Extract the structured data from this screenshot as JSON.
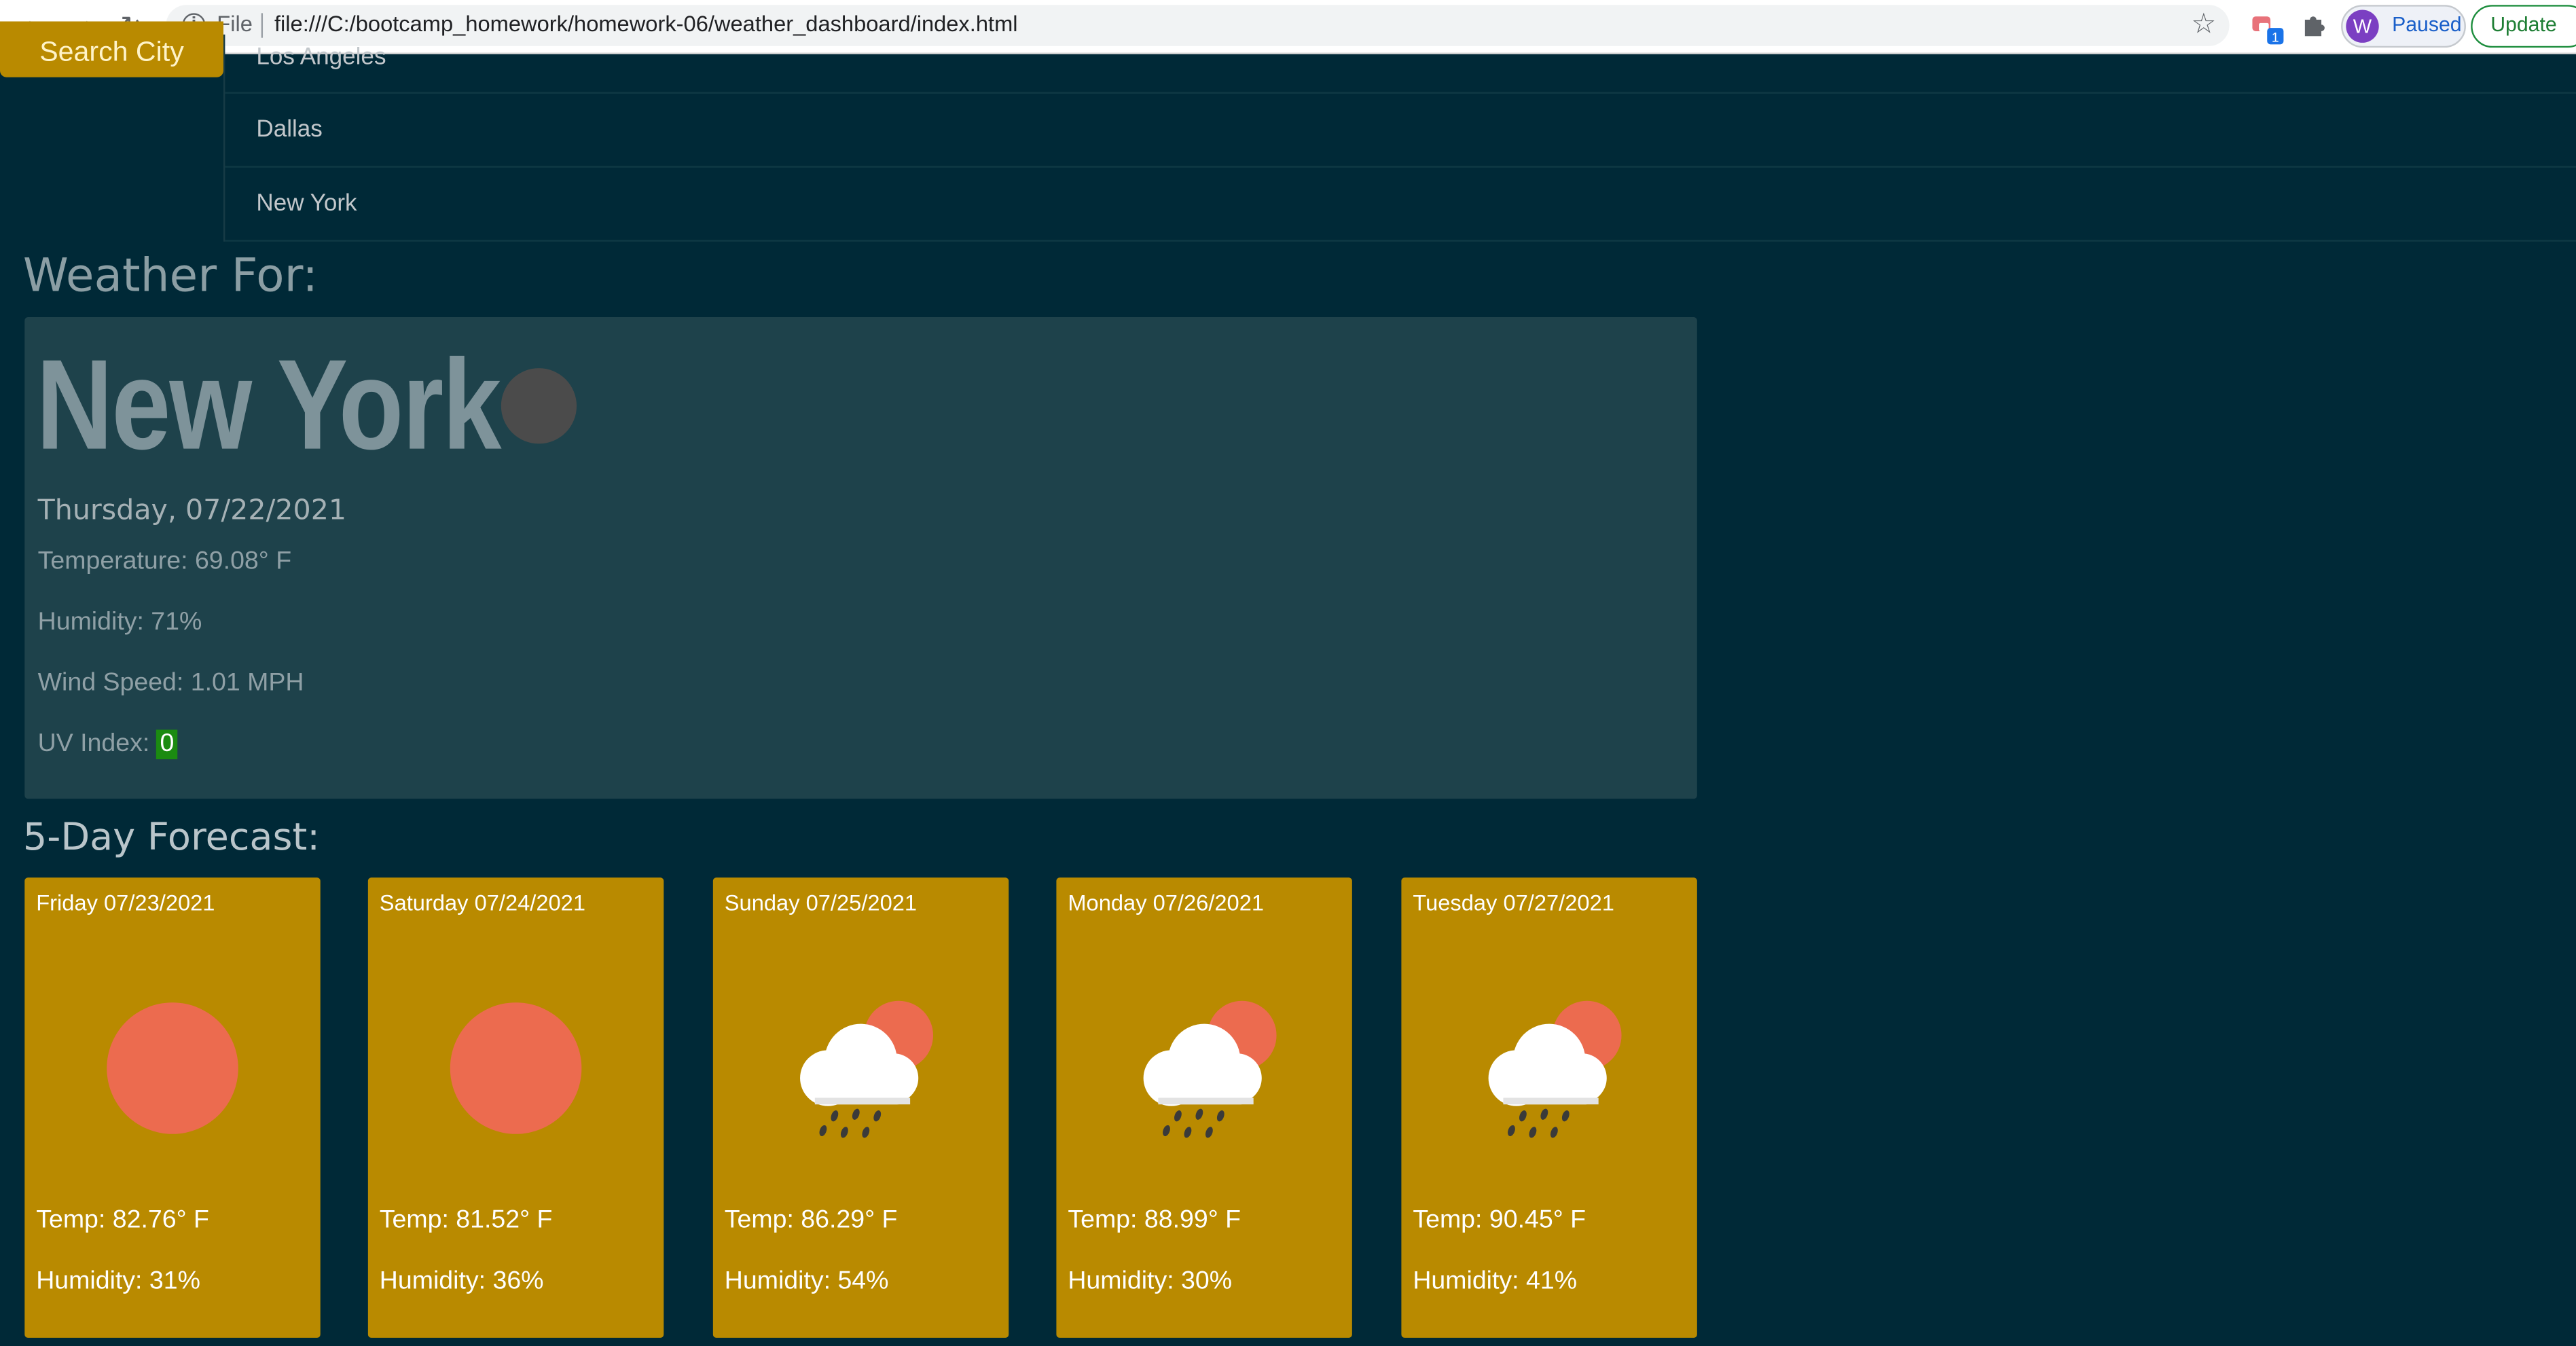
{
  "browser": {
    "back_icon": "arrow-left-icon",
    "forward_icon": "arrow-right-icon",
    "reload_icon": "reload-icon",
    "scheme": "File",
    "url": "file:///C:/bootcamp_homework/homework-06/weather_dashboard/index.html",
    "profile_initial": "W",
    "profile_status": "Paused",
    "update_label": "Update",
    "extension_badge": "1"
  },
  "search": {
    "button_label": "Search City"
  },
  "history": [
    "Los Angeles",
    "Dallas",
    "New York"
  ],
  "current": {
    "heading": "Weather For:",
    "city": "New York",
    "date": "Thursday, 07/22/2021",
    "temperature": "Temperature: 69.08° F",
    "humidity": "Humidity: 71%",
    "wind": "Wind Speed: 1.01 MPH",
    "uv_label": "UV Index: ",
    "uv_value": "0",
    "uv_color": "#1b8b11"
  },
  "forecast": {
    "title": "5-Day Forecast:",
    "days": [
      {
        "date": "Friday 07/23/2021",
        "icon": "sun-icon",
        "temp": "Temp: 82.76° F",
        "humidity": "Humidity: 31%"
      },
      {
        "date": "Saturday 07/24/2021",
        "icon": "sun-icon",
        "temp": "Temp: 81.52° F",
        "humidity": "Humidity: 36%"
      },
      {
        "date": "Sunday 07/25/2021",
        "icon": "sun-rain-cloud-icon",
        "temp": "Temp: 86.29° F",
        "humidity": "Humidity: 54%"
      },
      {
        "date": "Monday 07/26/2021",
        "icon": "sun-rain-cloud-icon",
        "temp": "Temp: 88.99° F",
        "humidity": "Humidity: 30%"
      },
      {
        "date": "Tuesday 07/27/2021",
        "icon": "sun-rain-cloud-icon",
        "temp": "Temp: 90.45° F",
        "humidity": "Humidity: 41%"
      }
    ]
  },
  "colors": {
    "page_background": "#002937",
    "card_background": "#1e424b",
    "forecast_card": "#b98a00",
    "sun": "#ec6b4f"
  }
}
